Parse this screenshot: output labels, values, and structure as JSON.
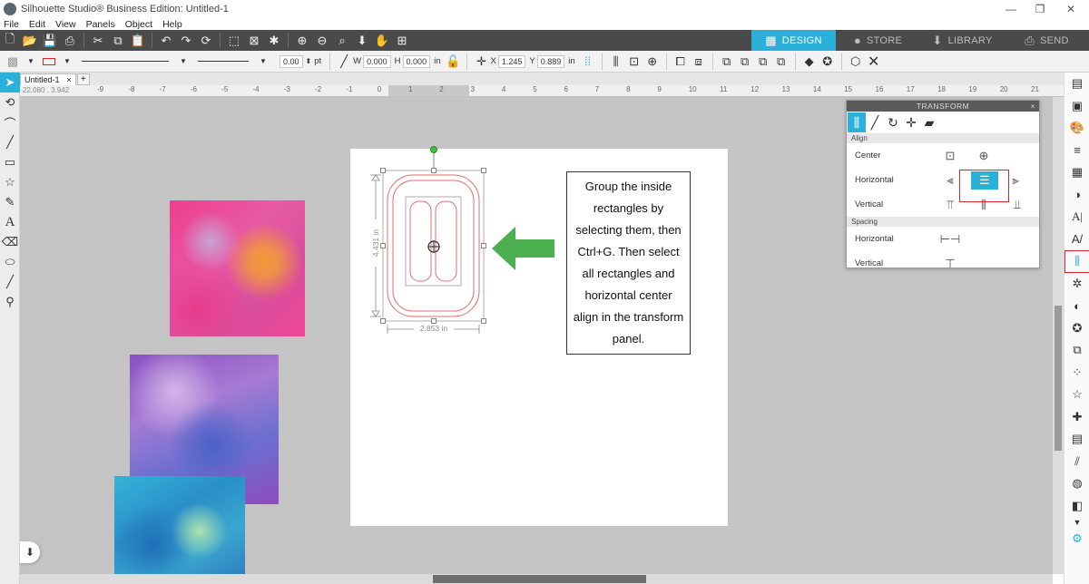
{
  "window": {
    "title": "Silhouette Studio® Business Edition: Untitled-1",
    "controls": [
      "—",
      "❐",
      "✕"
    ]
  },
  "menu": [
    "File",
    "Edit",
    "View",
    "Panels",
    "Object",
    "Help"
  ],
  "mode_tabs": [
    {
      "label": "DESIGN",
      "icon": "design-grid-icon",
      "active": true
    },
    {
      "label": "STORE",
      "icon": "store-s-icon",
      "active": false
    },
    {
      "label": "LIBRARY",
      "icon": "library-download-icon",
      "active": false
    },
    {
      "label": "SEND",
      "icon": "send-machine-icon",
      "active": false
    }
  ],
  "properties": {
    "line_width": "0.00",
    "line_unit": "pt",
    "w_label": "W",
    "w_value": "0.000",
    "h_label": "H",
    "h_value": "0.000",
    "size_unit": "in",
    "x_label": "X",
    "x_value": "1.245",
    "y_label": "Y",
    "y_value": "0.889",
    "pos_unit": "in"
  },
  "document": {
    "tab_label": "Untitled-1",
    "close": "×",
    "add": "+",
    "cursor_coords": "22.080 , 3.942"
  },
  "ruler_ticks": [
    "-9",
    "-8",
    "-7",
    "-6",
    "-5",
    "-4",
    "-3",
    "-2",
    "-1",
    "0",
    "1",
    "2",
    "3",
    "4",
    "5",
    "6",
    "7",
    "8",
    "9",
    "10",
    "11",
    "12",
    "13",
    "14",
    "15",
    "16",
    "17",
    "18",
    "19",
    "20",
    "21"
  ],
  "selection": {
    "height_label": "4.431 in",
    "width_label": "2.853 in"
  },
  "callout": {
    "text": "Group the inside rectangles by selecting them, then Ctrl+G. Then select all rectangles and horizontal center align in the transform panel."
  },
  "transform_panel": {
    "title": "TRANSFORM",
    "close": "×",
    "align_section": "Align",
    "rows": {
      "center": "Center",
      "horizontal": "Horizontal",
      "vertical": "Vertical"
    },
    "spacing_section": "Spacing",
    "spacing_rows": {
      "horizontal": "Horizontal",
      "vertical": "Vertical"
    }
  },
  "colors": {
    "accent": "#2ab0d9",
    "toolbar_bg": "#4a4a4a",
    "highlight_box": "#d8242a",
    "arrow": "#4caf50",
    "shape_stroke": "#e46c6c"
  }
}
